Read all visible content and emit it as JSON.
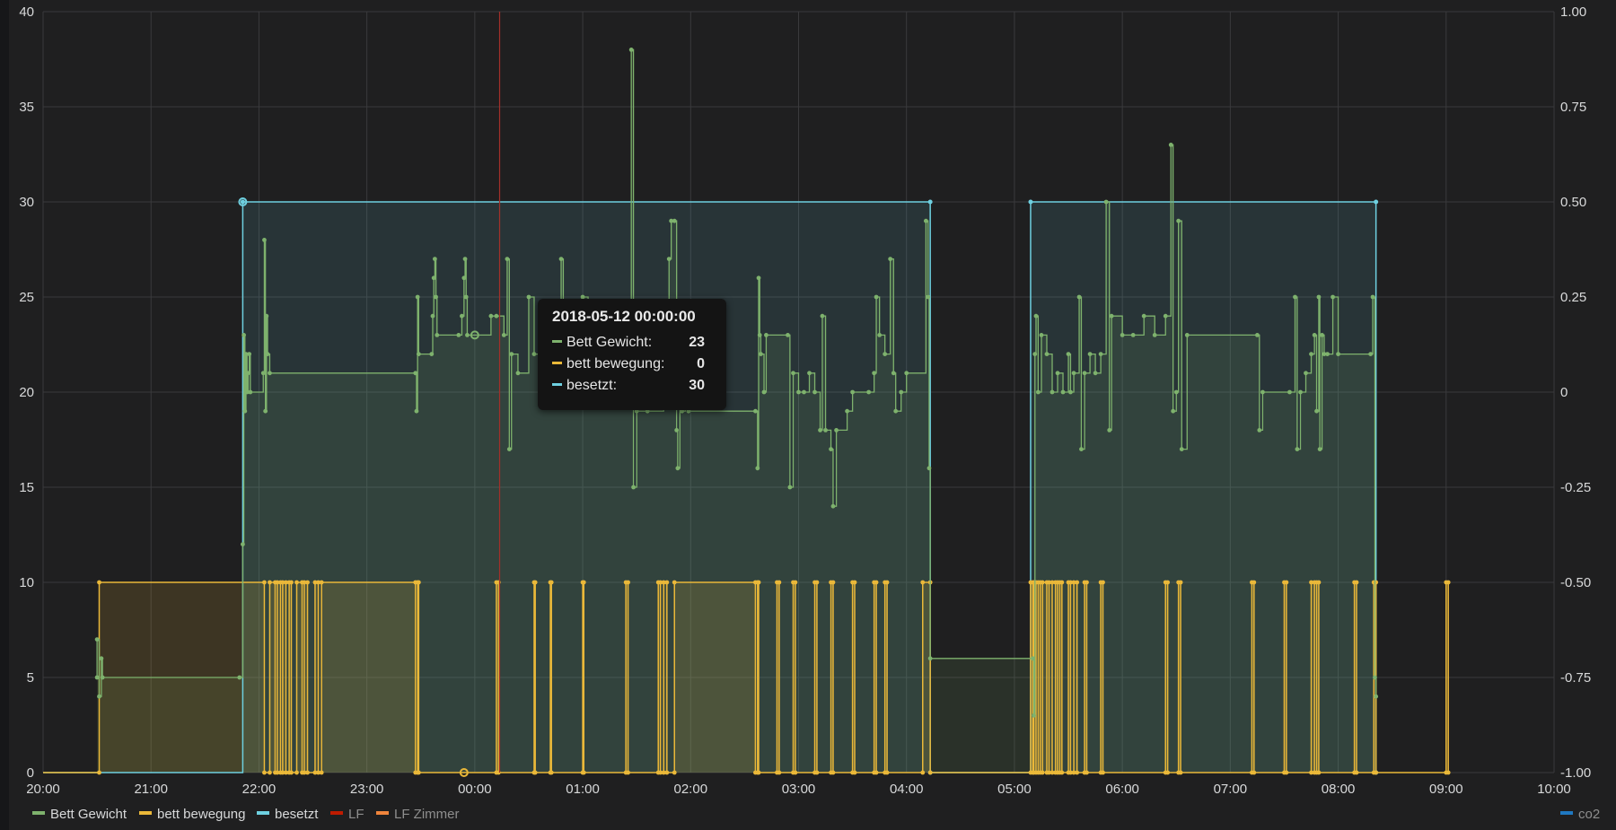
{
  "chart_data": {
    "type": "line",
    "x_ticks": [
      "20:00",
      "21:00",
      "22:00",
      "23:00",
      "00:00",
      "01:00",
      "02:00",
      "03:00",
      "04:00",
      "05:00",
      "06:00",
      "07:00",
      "08:00",
      "09:00",
      "10:00"
    ],
    "y_left_ticks": [
      "0",
      "5",
      "10",
      "15",
      "20",
      "25",
      "30",
      "35",
      "40"
    ],
    "y_right_ticks": [
      "-1.00",
      "-0.75",
      "-0.50",
      "-0.25",
      "0",
      "0.25",
      "0.50",
      "0.75",
      "1.00"
    ],
    "ylim_left": [
      0,
      40
    ],
    "ylim_right": [
      -1.0,
      1.0
    ],
    "grid": true,
    "legend_position": "bottom",
    "series": [
      {
        "name": "Bett Gewicht",
        "color": "#7eb26d",
        "fill": true,
        "points": [
          [
            -3.5,
            5
          ],
          [
            -3.5,
            7
          ],
          [
            -3.48,
            4
          ],
          [
            -3.46,
            6
          ],
          [
            -3.45,
            5
          ],
          [
            -2.18,
            5
          ],
          [
            -2.15,
            12
          ],
          [
            -2.14,
            23
          ],
          [
            -2.13,
            19
          ],
          [
            -2.12,
            22
          ],
          [
            -2.11,
            20
          ],
          [
            -2.1,
            21
          ],
          [
            -2.09,
            22
          ],
          [
            -2.08,
            20
          ],
          [
            -1.96,
            21
          ],
          [
            -1.95,
            28
          ],
          [
            -1.94,
            19
          ],
          [
            -1.93,
            24
          ],
          [
            -1.92,
            22
          ],
          [
            -1.9,
            21
          ],
          [
            -0.55,
            21
          ],
          [
            -0.54,
            19
          ],
          [
            -0.53,
            25
          ],
          [
            -0.52,
            22
          ],
          [
            -0.4,
            22
          ],
          [
            -0.39,
            24
          ],
          [
            -0.38,
            26
          ],
          [
            -0.37,
            27
          ],
          [
            -0.36,
            25
          ],
          [
            -0.35,
            23
          ],
          [
            -0.15,
            23
          ],
          [
            -0.12,
            24
          ],
          [
            -0.1,
            26
          ],
          [
            -0.09,
            27
          ],
          [
            -0.08,
            25
          ],
          [
            -0.07,
            23
          ],
          [
            0.15,
            24
          ],
          [
            0.2,
            24
          ],
          [
            0.27,
            23
          ],
          [
            0.3,
            27
          ],
          [
            0.32,
            17
          ],
          [
            0.34,
            22
          ],
          [
            0.4,
            21
          ],
          [
            0.5,
            25
          ],
          [
            0.55,
            22
          ],
          [
            0.8,
            27
          ],
          [
            0.82,
            22
          ],
          [
            0.85,
            21
          ],
          [
            1.0,
            25
          ],
          [
            1.05,
            22
          ],
          [
            1.45,
            38
          ],
          [
            1.47,
            15
          ],
          [
            1.5,
            19
          ],
          [
            1.6,
            19
          ],
          [
            1.75,
            22
          ],
          [
            1.8,
            27
          ],
          [
            1.82,
            29
          ],
          [
            1.85,
            29
          ],
          [
            1.87,
            18
          ],
          [
            1.88,
            16
          ],
          [
            1.9,
            21
          ],
          [
            1.92,
            19
          ],
          [
            1.95,
            22
          ],
          [
            1.98,
            19
          ],
          [
            2.6,
            19
          ],
          [
            2.62,
            16
          ],
          [
            2.63,
            26
          ],
          [
            2.64,
            23
          ],
          [
            2.65,
            22
          ],
          [
            2.68,
            20
          ],
          [
            2.7,
            23
          ],
          [
            2.9,
            23
          ],
          [
            2.92,
            15
          ],
          [
            2.95,
            21
          ],
          [
            3.0,
            20
          ],
          [
            3.05,
            20
          ],
          [
            3.1,
            21
          ],
          [
            3.15,
            20
          ],
          [
            3.2,
            18
          ],
          [
            3.22,
            24
          ],
          [
            3.25,
            18
          ],
          [
            3.3,
            17
          ],
          [
            3.32,
            14
          ],
          [
            3.35,
            18
          ],
          [
            3.45,
            19
          ],
          [
            3.5,
            20
          ],
          [
            3.65,
            20
          ],
          [
            3.7,
            21
          ],
          [
            3.72,
            25
          ],
          [
            3.75,
            23
          ],
          [
            3.8,
            22
          ],
          [
            3.85,
            27
          ],
          [
            3.88,
            21
          ],
          [
            3.9,
            19
          ],
          [
            3.95,
            20
          ],
          [
            4.0,
            21
          ],
          [
            4.18,
            29
          ],
          [
            4.2,
            25
          ],
          [
            4.21,
            16
          ],
          [
            4.22,
            6
          ],
          [
            5.17,
            6
          ],
          [
            5.18,
            3
          ],
          [
            5.19,
            22
          ],
          [
            5.2,
            24
          ],
          [
            5.22,
            20
          ],
          [
            5.25,
            23
          ],
          [
            5.3,
            22
          ],
          [
            5.35,
            20
          ],
          [
            5.4,
            21
          ],
          [
            5.45,
            20
          ],
          [
            5.5,
            22
          ],
          [
            5.52,
            20
          ],
          [
            5.55,
            21
          ],
          [
            5.6,
            25
          ],
          [
            5.62,
            17
          ],
          [
            5.65,
            21
          ],
          [
            5.7,
            22
          ],
          [
            5.75,
            21
          ],
          [
            5.8,
            22
          ],
          [
            5.85,
            30
          ],
          [
            5.88,
            18
          ],
          [
            5.9,
            24
          ],
          [
            6.0,
            23
          ],
          [
            6.1,
            23
          ],
          [
            6.2,
            24
          ],
          [
            6.3,
            23
          ],
          [
            6.4,
            24
          ],
          [
            6.45,
            33
          ],
          [
            6.47,
            19
          ],
          [
            6.5,
            20
          ],
          [
            6.52,
            29
          ],
          [
            6.55,
            17
          ],
          [
            6.6,
            23
          ],
          [
            7.25,
            23
          ],
          [
            7.27,
            18
          ],
          [
            7.3,
            20
          ],
          [
            7.55,
            20
          ],
          [
            7.6,
            25
          ],
          [
            7.62,
            17
          ],
          [
            7.65,
            20
          ],
          [
            7.7,
            21
          ],
          [
            7.75,
            22
          ],
          [
            7.78,
            23
          ],
          [
            7.8,
            19
          ],
          [
            7.82,
            25
          ],
          [
            7.83,
            17
          ],
          [
            7.85,
            23
          ],
          [
            7.87,
            22
          ],
          [
            7.9,
            22
          ],
          [
            7.95,
            25
          ],
          [
            8.0,
            22
          ],
          [
            8.3,
            22
          ],
          [
            8.32,
            25
          ],
          [
            8.34,
            5
          ],
          [
            8.35,
            4
          ]
        ]
      },
      {
        "name": "bett bewegung",
        "color": "#eab839",
        "fill": true,
        "pulses": [
          [
            -3.48,
            -1.95
          ],
          [
            -1.9,
            -1.85
          ],
          [
            -1.83,
            -1.8
          ],
          [
            -1.78,
            -1.75
          ],
          [
            -1.72,
            -1.7
          ],
          [
            -1.65,
            -1.6
          ],
          [
            -1.58,
            -1.55
          ],
          [
            -1.48,
            -1.45
          ],
          [
            -1.42,
            -0.55
          ],
          [
            -0.53,
            -0.52
          ],
          [
            0.2,
            0.22
          ],
          [
            0.55,
            0.56
          ],
          [
            0.7,
            0.71
          ],
          [
            1.0,
            1.01
          ],
          [
            1.4,
            1.42
          ],
          [
            1.7,
            1.72
          ],
          [
            1.75,
            1.78
          ],
          [
            1.85,
            2.6
          ],
          [
            2.62,
            2.63
          ],
          [
            2.8,
            2.82
          ],
          [
            2.95,
            2.97
          ],
          [
            3.15,
            3.17
          ],
          [
            3.3,
            3.32
          ],
          [
            3.5,
            3.52
          ],
          [
            3.7,
            3.72
          ],
          [
            3.8,
            3.82
          ],
          [
            4.15,
            4.22
          ],
          [
            5.15,
            5.17
          ],
          [
            5.18,
            5.2
          ],
          [
            5.22,
            5.24
          ],
          [
            5.26,
            5.3
          ],
          [
            5.32,
            5.35
          ],
          [
            5.38,
            5.4
          ],
          [
            5.42,
            5.44
          ],
          [
            5.5,
            5.52
          ],
          [
            5.55,
            5.58
          ],
          [
            5.65,
            5.67
          ],
          [
            5.8,
            5.82
          ],
          [
            6.4,
            6.42
          ],
          [
            6.52,
            6.54
          ],
          [
            7.2,
            7.22
          ],
          [
            7.5,
            7.52
          ],
          [
            7.75,
            7.78
          ],
          [
            7.8,
            7.82
          ],
          [
            8.15,
            8.17
          ],
          [
            8.33,
            8.35
          ],
          [
            9.0,
            9.02
          ]
        ]
      },
      {
        "name": "besetzt",
        "color": "#6ed0e0",
        "fill": true,
        "blocks": [
          [
            -2.15,
            4.22
          ],
          [
            5.15,
            8.35
          ]
        ],
        "high": 30,
        "low": 0
      }
    ],
    "hidden_series": [
      {
        "name": "LF",
        "color": "#bf1b00"
      },
      {
        "name": "LF Zimmer",
        "color": "#ef843c"
      },
      {
        "name": "co2",
        "color": "#1f78c1"
      }
    ],
    "marker_line_hour": 0.23,
    "tooltip": {
      "time": "2018-05-12 00:00:00",
      "rows": [
        {
          "label": "Bett Gewicht:",
          "value": "23",
          "color": "#7eb26d"
        },
        {
          "label": "bett bewegung:",
          "value": "0",
          "color": "#eab839"
        },
        {
          "label": "besetzt:",
          "value": "30",
          "color": "#6ed0e0"
        }
      ]
    }
  }
}
